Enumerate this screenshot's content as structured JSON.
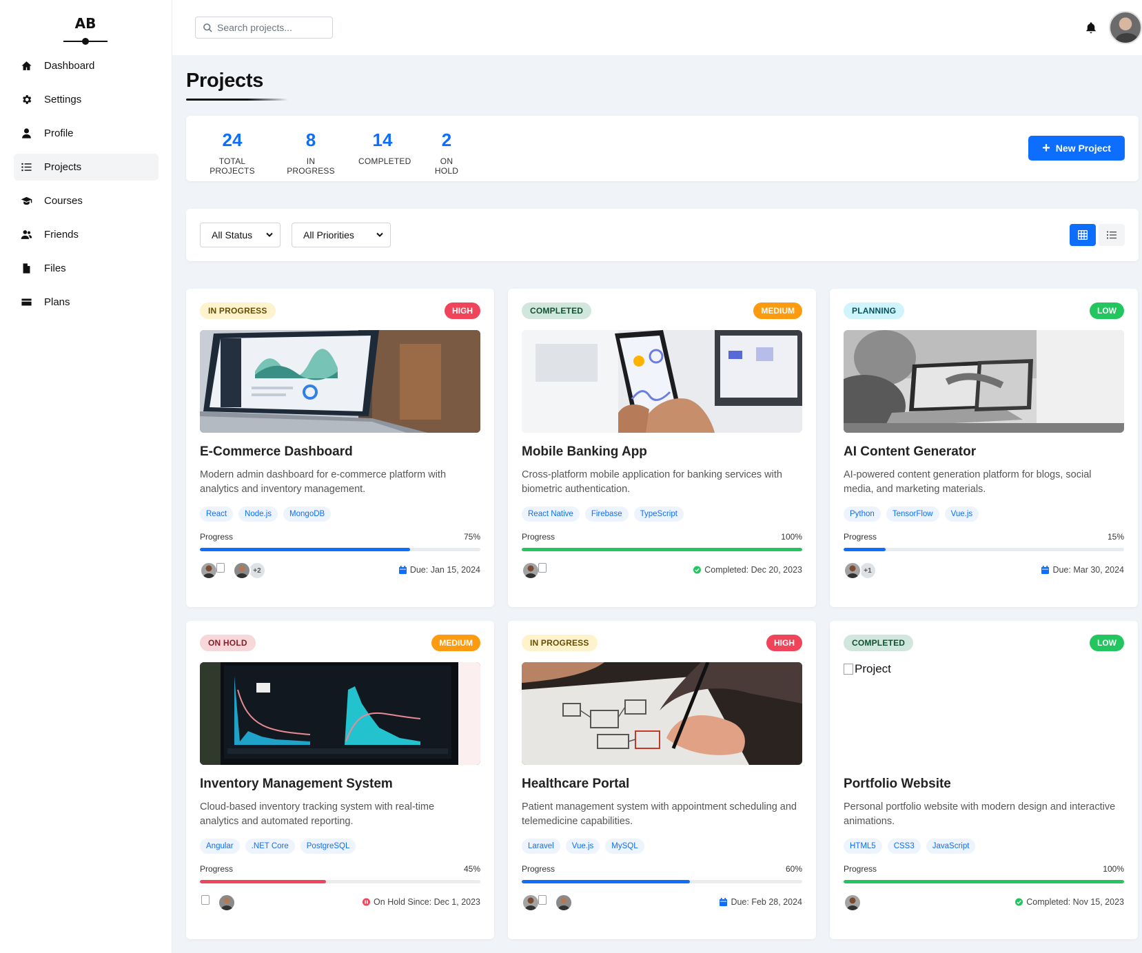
{
  "brand": {
    "logo_text": "AB"
  },
  "sidebar": {
    "items": [
      {
        "label": "Dashboard",
        "icon": "home-icon"
      },
      {
        "label": "Settings",
        "icon": "gear-icon"
      },
      {
        "label": "Profile",
        "icon": "user-icon"
      },
      {
        "label": "Projects",
        "icon": "list-icon",
        "active": true
      },
      {
        "label": "Courses",
        "icon": "graduation-cap-icon"
      },
      {
        "label": "Friends",
        "icon": "users-icon"
      },
      {
        "label": "Files",
        "icon": "file-icon"
      },
      {
        "label": "Plans",
        "icon": "credit-card-icon"
      }
    ]
  },
  "topbar": {
    "search_placeholder": "Search projects..."
  },
  "page": {
    "title": "Projects"
  },
  "stats": [
    {
      "value": "24",
      "label": "TOTAL PROJECTS"
    },
    {
      "value": "8",
      "label": "IN PROGRESS"
    },
    {
      "value": "14",
      "label": "COMPLETED"
    },
    {
      "value": "2",
      "label": "ON HOLD"
    }
  ],
  "actions": {
    "new_project": "New Project"
  },
  "filters": {
    "status": "All Status",
    "priority": "All Priorities"
  },
  "colors": {
    "accent": "#0d6efd",
    "high": "#f0445b",
    "medium": "#fd9b10",
    "low": "#22c55e"
  },
  "projects": [
    {
      "status": "IN PROGRESS",
      "priority": "HIGH",
      "title": "E-Commerce Dashboard",
      "description": "Modern admin dashboard for e-commerce platform with analytics and inventory management.",
      "tags": [
        "React",
        "Node.js",
        "MongoDB"
      ],
      "progress_label": "Progress",
      "progress_text": "75%",
      "progress": 75,
      "more_members": "+2",
      "due": "Due: Jan 15, 2024"
    },
    {
      "status": "COMPLETED",
      "priority": "MEDIUM",
      "title": "Mobile Banking App",
      "description": "Cross-platform mobile application for banking services with biometric authentication.",
      "tags": [
        "React Native",
        "Firebase",
        "TypeScript"
      ],
      "progress_label": "Progress",
      "progress_text": "100%",
      "progress": 100,
      "due": "Completed: Dec 20, 2023"
    },
    {
      "status": "PLANNING",
      "priority": "LOW",
      "title": "AI Content Generator",
      "description": "AI-powered content generation platform for blogs, social media, and marketing materials.",
      "tags": [
        "Python",
        "TensorFlow",
        "Vue.js"
      ],
      "progress_label": "Progress",
      "progress_text": "15%",
      "progress": 15,
      "more_members": "+1",
      "due": "Due: Mar 30, 2024"
    },
    {
      "status": "ON HOLD",
      "priority": "MEDIUM",
      "title": "Inventory Management System",
      "description": "Cloud-based inventory tracking system with real-time analytics and automated reporting.",
      "tags": [
        "Angular",
        ".NET Core",
        "PostgreSQL"
      ],
      "progress_label": "Progress",
      "progress_text": "45%",
      "progress": 45,
      "due": "On Hold Since: Dec 1, 2023"
    },
    {
      "status": "IN PROGRESS",
      "priority": "HIGH",
      "title": "Healthcare Portal",
      "description": "Patient management system with appointment scheduling and telemedicine capabilities.",
      "tags": [
        "Laravel",
        "Vue.js",
        "MySQL"
      ],
      "progress_label": "Progress",
      "progress_text": "60%",
      "progress": 60,
      "due": "Due: Feb 28, 2024"
    },
    {
      "status": "COMPLETED",
      "priority": "LOW",
      "title": "Portfolio Website",
      "image_alt": "Project",
      "description": "Personal portfolio website with modern design and interactive animations.",
      "tags": [
        "HTML5",
        "CSS3",
        "JavaScript"
      ],
      "progress_label": "Progress",
      "progress_text": "100%",
      "progress": 100,
      "due": "Completed: Nov 15, 2023"
    }
  ]
}
